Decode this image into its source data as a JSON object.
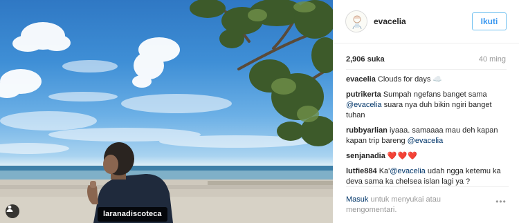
{
  "photo": {
    "tagged_user": "laranadiscoteca",
    "user_tag_icon": "person-icon"
  },
  "post": {
    "username": "evacelia",
    "follow_label": "Ikuti",
    "likes": "2,906 suka",
    "time": "40 ming"
  },
  "caption": {
    "author": "evacelia",
    "text": "Clouds for days ☁️"
  },
  "comments": [
    {
      "author": "putrikerta",
      "text_before": "Sumpah ngefans banget sama ",
      "mention": "@evacelia",
      "text_after": " suara nya duh bikin ngiri banget tuhan"
    },
    {
      "author": "rubbyarlian",
      "text_before": "iyaaa. samaaaa mau deh kapan kapan trip bareng ",
      "mention": "@evacelia",
      "text_after": ""
    },
    {
      "author": "senjanadia",
      "text_before": "",
      "hearts": "❤️❤️❤️",
      "text_after": ""
    },
    {
      "author": "lutfie884",
      "text_before": "Ka'",
      "mention": "@evacelia",
      "text_after": " udah ngga ketemu ka deva sama ka chelsea islan lagi ya ?"
    }
  ],
  "footer": {
    "login_link": "Masuk",
    "login_text": " untuk menyukai atau mengomentari.",
    "more_label": "•••",
    "more_icon": "more-options-icon"
  },
  "colors": {
    "accent": "#3897f0",
    "link": "#003569",
    "heart": "#e0323c",
    "muted": "#999999"
  }
}
